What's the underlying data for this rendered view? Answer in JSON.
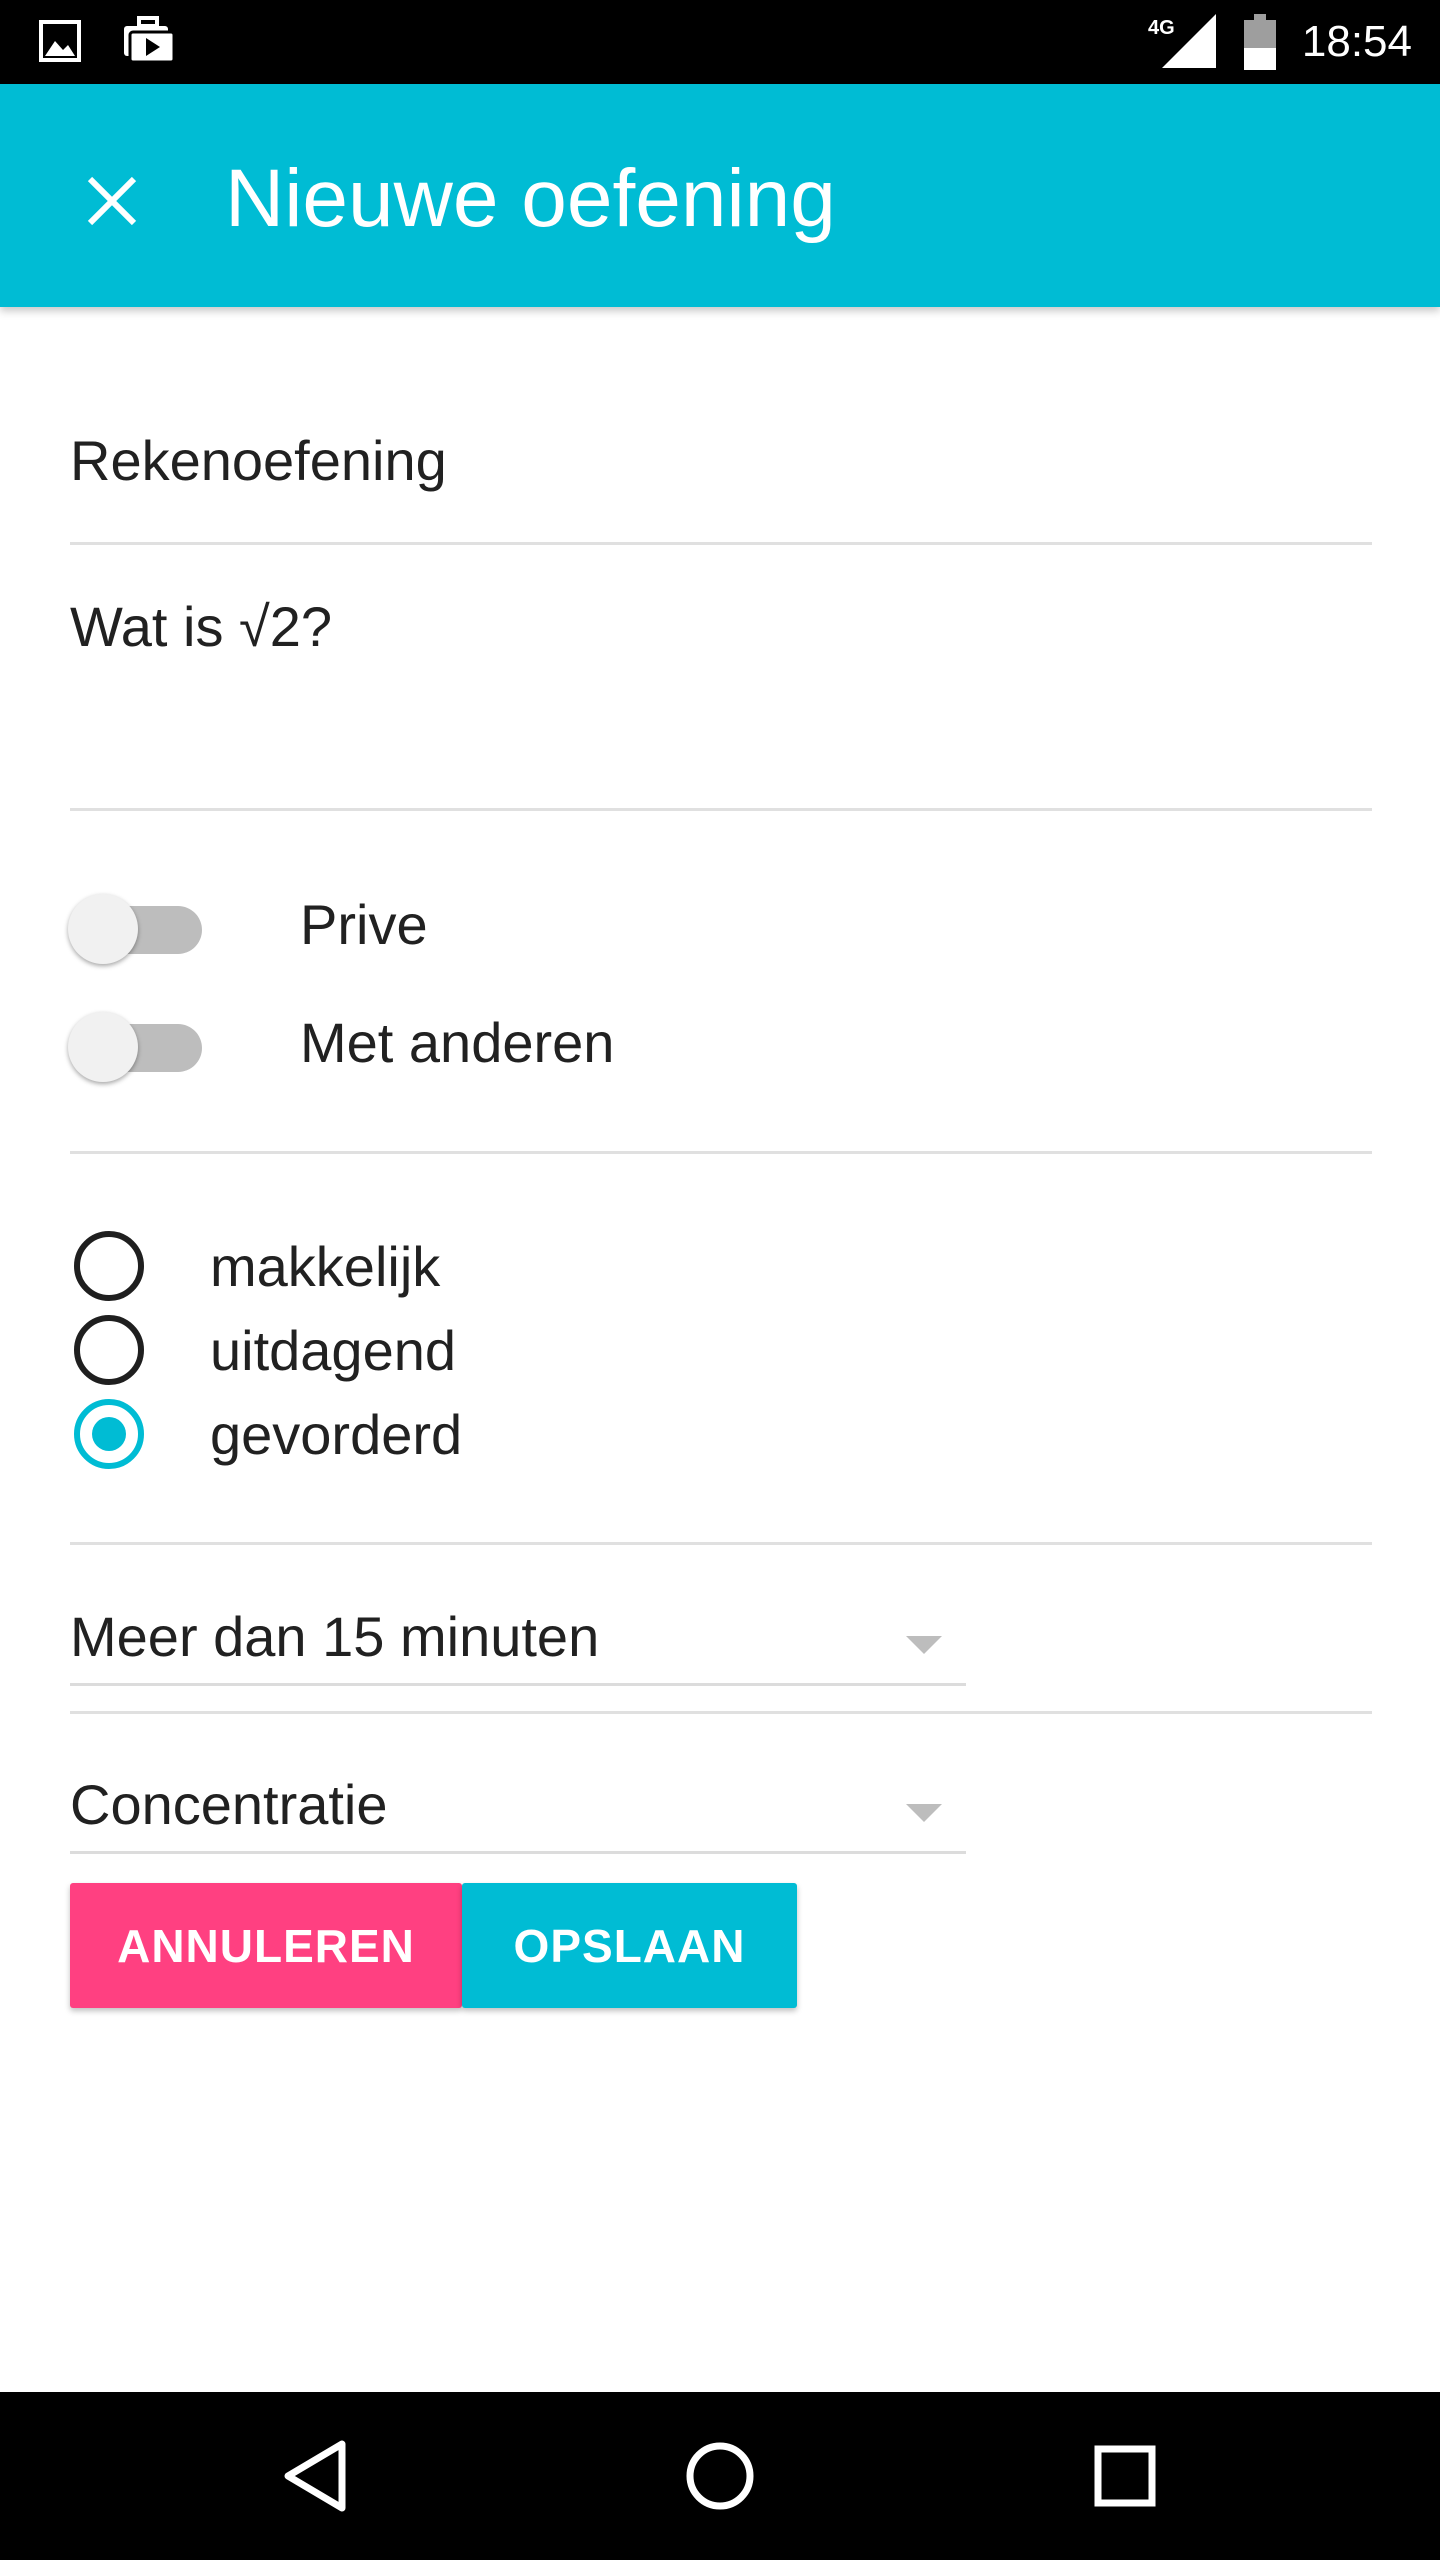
{
  "status_bar": {
    "network": "4G",
    "time": "18:54",
    "icons": [
      "image-notification-icon",
      "briefcase-notification-icon",
      "cell-signal-icon",
      "battery-icon"
    ]
  },
  "app_bar": {
    "title": "Nieuwe oefening",
    "close_icon": "close-icon"
  },
  "form": {
    "title_value": "Rekenoefening",
    "question_value": "Wat is √2?",
    "switches": [
      {
        "label": "Prive",
        "on": false
      },
      {
        "label": "Met anderen",
        "on": false
      }
    ],
    "difficulty": {
      "options": [
        "makkelijk",
        "uitdagend",
        "gevorderd"
      ],
      "selected": "gevorderd"
    },
    "duration_select": {
      "value": "Meer dan 15 minuten"
    },
    "category_select": {
      "value": "Concentratie"
    }
  },
  "actions": {
    "cancel_label": "ANNULEREN",
    "save_label": "OPSLAAN"
  },
  "colors": {
    "primary": "#00bcd4",
    "accent": "#ff4081"
  },
  "nav_bar": {
    "icons": [
      "back-triangle-icon",
      "home-circle-icon",
      "recents-square-icon"
    ]
  }
}
